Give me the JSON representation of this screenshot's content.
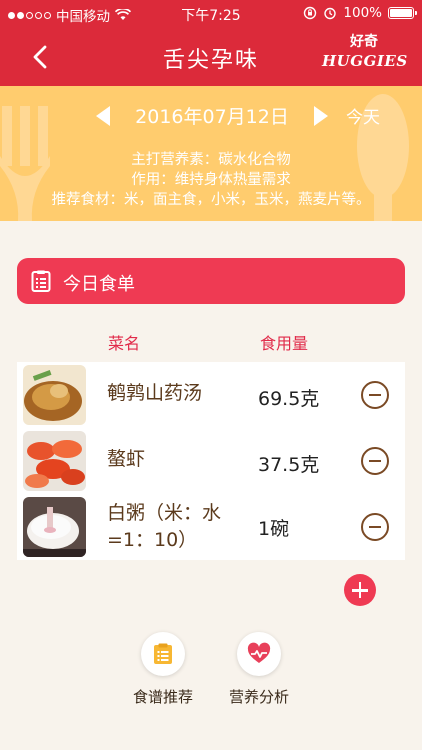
{
  "status_bar": {
    "carrier": "中国移动",
    "time": "下午7:25",
    "battery": "100%",
    "signal_filled": 2,
    "signal_total": 5
  },
  "nav": {
    "title": "舌尖孕味",
    "brand_cn": "好奇",
    "brand_en": "HUGGIES",
    "back_icon": "back-chevron-icon"
  },
  "banner": {
    "date": "2016年07月12日",
    "today_label": "今天",
    "nutrient_line": "主打营养素：碳水化合物",
    "effect_line": "作用：维持身体热量需求",
    "foods_line": "推荐食材：米，面主食，小米，玉米，燕麦片等。"
  },
  "menu": {
    "header_label": "今日食单",
    "col_name": "菜名",
    "col_amount": "食用量",
    "dishes": [
      {
        "name": "鹌鹑山药汤",
        "amount": "69.5克"
      },
      {
        "name": "螯虾",
        "amount": "37.5克"
      },
      {
        "name": "白粥（米：水=1：10）",
        "amount": "1碗"
      }
    ]
  },
  "actions": {
    "recipe_label": "食谱推荐",
    "analysis_label": "营养分析"
  },
  "colors": {
    "brand_red": "#dc2a3a",
    "accent_pink": "#ef3a53",
    "banner_yellow": "#ffcc6e",
    "background": "#f8f3ec"
  }
}
